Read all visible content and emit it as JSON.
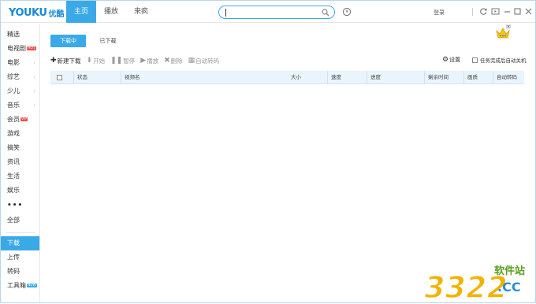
{
  "app": {
    "logo_text": "YOUKU",
    "logo_cn": "优酷"
  },
  "nav": {
    "tabs": [
      {
        "label": "主页",
        "active": true
      },
      {
        "label": "播放",
        "active": false
      },
      {
        "label": "来疯",
        "active": false
      }
    ]
  },
  "search": {
    "value": "",
    "placeholder": ""
  },
  "header": {
    "login_label": "登录"
  },
  "sidebar": {
    "items": [
      {
        "label": "精选",
        "badge": "",
        "chevron": false
      },
      {
        "label": "电视剧",
        "badge": "HOT",
        "chevron": true
      },
      {
        "label": "电影",
        "badge": "",
        "chevron": true
      },
      {
        "label": "综艺",
        "badge": "",
        "chevron": true
      },
      {
        "label": "少儿",
        "badge": "",
        "chevron": true
      },
      {
        "label": "音乐",
        "badge": "",
        "chevron": true
      },
      {
        "label": "会员",
        "badge": "VIP",
        "chevron": false
      },
      {
        "label": "游戏",
        "badge": "",
        "chevron": false
      },
      {
        "label": "搞笑",
        "badge": "",
        "chevron": false
      },
      {
        "label": "资讯",
        "badge": "",
        "chevron": false
      },
      {
        "label": "生活",
        "badge": "",
        "chevron": false
      },
      {
        "label": "娱乐",
        "badge": "",
        "chevron": false
      }
    ],
    "more_label": "•••",
    "all_label": "全部",
    "bottom_items": [
      {
        "label": "下载",
        "active": true,
        "badge": ""
      },
      {
        "label": "上传",
        "active": false,
        "badge": ""
      },
      {
        "label": "转码",
        "active": false,
        "badge": ""
      },
      {
        "label": "工具箱",
        "active": false,
        "badge": "NEW"
      }
    ]
  },
  "download": {
    "tabs": [
      {
        "label": "下载中",
        "active": true
      },
      {
        "label": "已下载",
        "active": false
      }
    ],
    "toolbar": {
      "new_label": "新建下载",
      "start_label": "开始",
      "pause_label": "暂停",
      "play_label": "播放",
      "delete_label": "删除",
      "transcode_label": "自动转码"
    },
    "settings_label": "设置",
    "auto_shutdown_label": "任务完成后自动关机",
    "table": {
      "columns": [
        "状态",
        "视频名",
        "大小",
        "速度",
        "进度",
        "剩余时间",
        "画质",
        "自动转码"
      ],
      "rows": []
    }
  },
  "watermark": {
    "number": "3322",
    "cn": "软件站",
    "suffix": ".CC"
  },
  "colors": {
    "accent": "#3aa9e8",
    "header_bg": "#e9f4fc",
    "hot_badge": "#f04a4a"
  }
}
